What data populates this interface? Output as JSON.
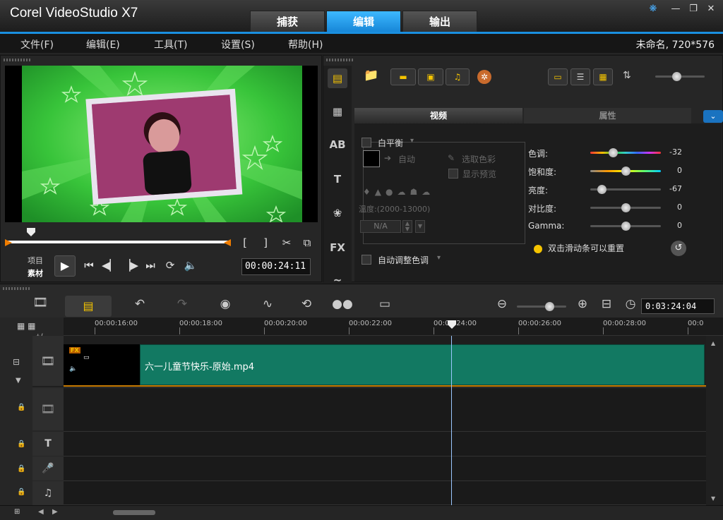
{
  "app": {
    "title": "Corel VideoStudio X7"
  },
  "mode_tabs": [
    {
      "label": "捕获"
    },
    {
      "label": "编辑"
    },
    {
      "label": "输出"
    }
  ],
  "window_buttons": {
    "help": "❋",
    "minimize": "—",
    "restore": "❐",
    "close": "✕"
  },
  "menu": {
    "items": [
      {
        "label": "文件(F)"
      },
      {
        "label": "编辑(E)"
      },
      {
        "label": "工具(T)"
      },
      {
        "label": "设置(S)"
      },
      {
        "label": "帮助(H)"
      }
    ],
    "project_info": "未命名, 720*576"
  },
  "player": {
    "mode_project": "项目",
    "mode_clip": "素材",
    "timecode": "00:00:24:11",
    "scrub_position": 0.11
  },
  "options": {
    "tabs": [
      {
        "label": "视频"
      },
      {
        "label": "属性"
      }
    ],
    "white_balance": {
      "label": "白平衡",
      "auto_label": "自动",
      "pick_color_label": "选取色彩",
      "show_preview_label": "显示预览",
      "temperature_label": "温度:(2000-13000)",
      "temperature_value": "N/A"
    },
    "auto_tone_label": "自动调整色调",
    "sliders": [
      {
        "label": "色调:",
        "value": "-32",
        "level": 0.32
      },
      {
        "label": "饱和度:",
        "value": "0",
        "level": 0.5
      },
      {
        "label": "亮度:",
        "value": "-67",
        "level": 0.16
      },
      {
        "label": "对比度:",
        "value": "0",
        "level": 0.5
      },
      {
        "label": "Gamma:",
        "value": "0",
        "level": 0.5
      }
    ],
    "reset_hint": "双击滑动条可以重置"
  },
  "timeline": {
    "duration": "0:03:24:04",
    "ruler_labels": [
      "00:00:16:00",
      "00:00:18:00",
      "00:00:20:00",
      "00:00:22:00",
      "00:00:24:00",
      "00:00:26:00",
      "00:00:28:00",
      "00:0"
    ],
    "clip_name": "六一儿童节快乐-原始.mp4",
    "add_track_label": "+/-"
  }
}
